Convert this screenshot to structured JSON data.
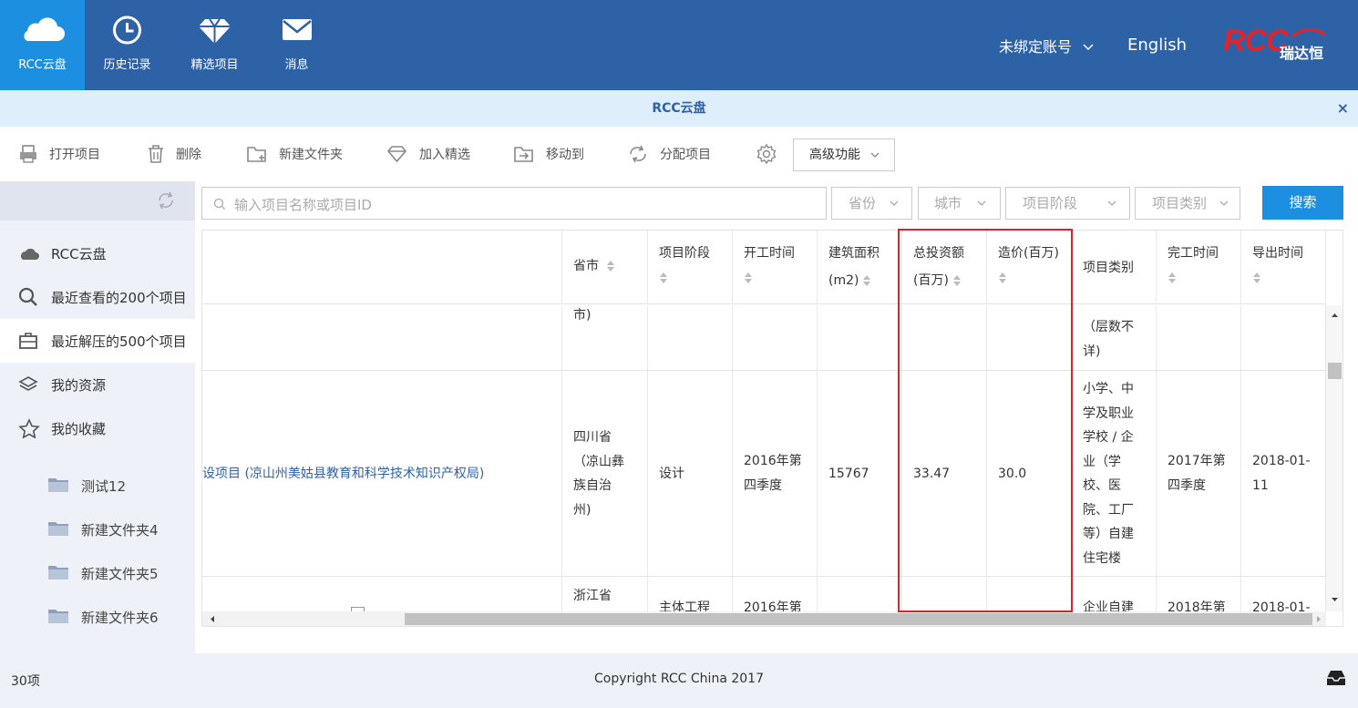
{
  "nav": [
    {
      "label": "RCC云盘",
      "icon": "cloud-icon"
    },
    {
      "label": "历史记录",
      "icon": "clock-icon"
    },
    {
      "label": "精选项目",
      "icon": "diamond-icon"
    },
    {
      "label": "消息",
      "icon": "mail-icon"
    }
  ],
  "account": {
    "label": "未绑定账号",
    "language": "English"
  },
  "brand": {
    "logo_text": "RCC",
    "logo_cn": "瑞达恒"
  },
  "window": {
    "title": "RCC云盘",
    "close": "×"
  },
  "toolbar": {
    "open": "打开项目",
    "delete": "删除",
    "new_folder": "新建文件夹",
    "add_featured": "加入精选",
    "move_to": "移动到",
    "assign": "分配项目",
    "advanced": "高级功能"
  },
  "sidebar": {
    "items": [
      {
        "label": "RCC云盘",
        "icon": "cloud-icon"
      },
      {
        "label": "最近查看的200个项目",
        "icon": "search-icon"
      },
      {
        "label": "最近解压的500个项目",
        "icon": "briefcase-icon"
      },
      {
        "label": "我的资源",
        "icon": "layers-icon"
      },
      {
        "label": "我的收藏",
        "icon": "star-icon"
      }
    ],
    "folders": [
      {
        "label": "测试12"
      },
      {
        "label": "新建文件夹4"
      },
      {
        "label": "新建文件夹5"
      },
      {
        "label": "新建文件夹6"
      }
    ]
  },
  "search": {
    "placeholder": "输入项目名称或项目ID",
    "province": "省份",
    "city": "城市",
    "stage": "项目阶段",
    "category": "项目类别",
    "button": "搜索"
  },
  "table": {
    "headers": {
      "province_city": "省市",
      "stage": "项目阶段",
      "start": "开工时间",
      "area_1": "建筑面积",
      "area_2": "(m2)",
      "invest_1": "总投资额",
      "invest_2": "(百万)",
      "cost": "造价(百万)",
      "category": "项目类别",
      "finish": "完工时间",
      "export": "导出时间"
    },
    "row_partial_top": {
      "province_tail": "市)",
      "category_lines": [
        "（层数不",
        "详)"
      ]
    },
    "row_main": {
      "name": "设项目 (凉山州美姑县教育和科学技术知识产权局)",
      "province_lines": [
        "四川省",
        "（凉山彝",
        "族自治",
        "州)"
      ],
      "stage": "设计",
      "start_lines": [
        "2016年第",
        "四季度"
      ],
      "area": "15767",
      "invest": "33.47",
      "cost": "30.0",
      "category_lines": [
        "小学、中",
        "学及职业",
        "学校 / 企",
        "业（学",
        "校、医",
        "院、工厂",
        "等）自建",
        "住宅楼"
      ],
      "finish_lines": [
        "2017年第",
        "四季度"
      ],
      "export_lines": [
        "2018-01-",
        "11"
      ]
    },
    "row_partial_bottom": {
      "province": "浙江省",
      "stage": "主体工程",
      "start": "2016年第",
      "category": "企业自建",
      "finish": "2018年第",
      "export": "2018-01-"
    }
  },
  "footer": {
    "count": "30项",
    "copyright": "Copyright RCC China 2017"
  }
}
